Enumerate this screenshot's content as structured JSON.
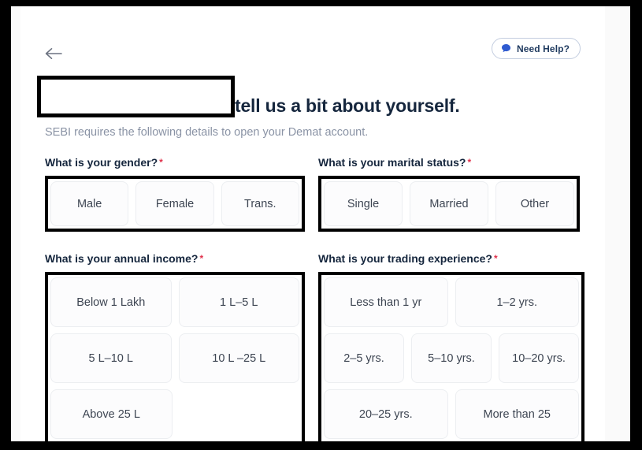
{
  "header": {
    "back_icon": "arrow-left-icon",
    "need_help_label": "Need Help?",
    "need_help_icon": "chat-bubble-icon"
  },
  "title": {
    "heading": "tell us a bit about yourself.",
    "subtitle": "SEBI requires the following details to open your Demat account."
  },
  "questions": {
    "gender": {
      "label": "What is your gender?",
      "required_marker": "*",
      "rows": [
        [
          "Male",
          "Female",
          "Trans."
        ]
      ]
    },
    "marital": {
      "label": "What is your marital status?",
      "required_marker": "*",
      "rows": [
        [
          "Single",
          "Married",
          "Other"
        ]
      ]
    },
    "income": {
      "label": "What is your annual income?",
      "required_marker": "*",
      "rows": [
        [
          "Below 1 Lakh",
          "1 L–5 L"
        ],
        [
          "5 L–10 L",
          "10 L –25 L"
        ],
        [
          "Above 25 L",
          ""
        ]
      ]
    },
    "trading": {
      "label": "What is your trading experience?",
      "required_marker": "*",
      "rows": [
        [
          "Less than 1 yr",
          "1–2 yrs."
        ],
        [
          "2–5 yrs.",
          "5–10 yrs.",
          "10–20 yrs."
        ],
        [
          "20–25 yrs.",
          "More than 25"
        ]
      ]
    }
  },
  "colors": {
    "title_navy": "#15263d",
    "subtitle_grey": "#8a93a5",
    "accent_blue": "#2f5bd0",
    "required_red": "#e0314b",
    "chip_bg": "#fcfcfd",
    "chip_border": "#eceef1",
    "annotation_black": "#000000"
  }
}
